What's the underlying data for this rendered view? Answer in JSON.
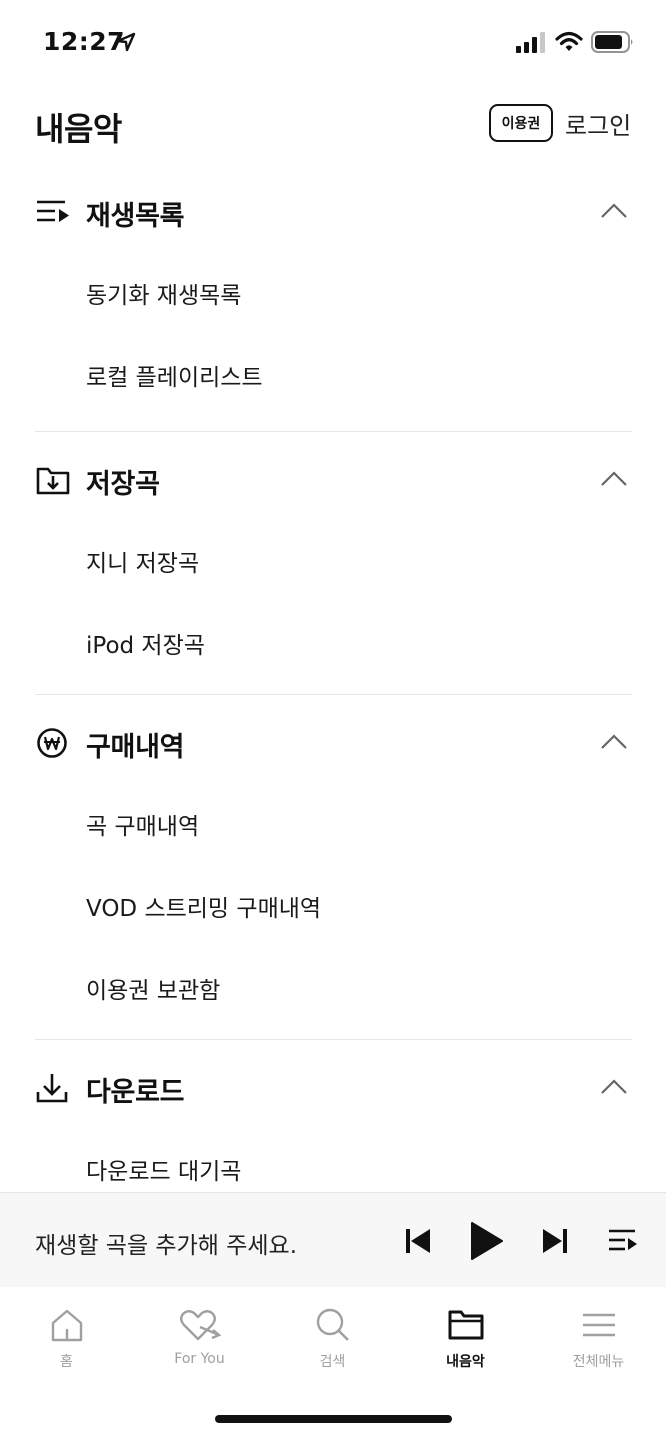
{
  "status_bar": {
    "time": "12:27"
  },
  "header": {
    "title": "내음악",
    "voucher_label": "이용권",
    "login_label": "로그인"
  },
  "sections": [
    {
      "title": "재생목록",
      "icon": "playlist-icon",
      "items": [
        "동기화 재생목록",
        "로컬 플레이리스트"
      ]
    },
    {
      "title": "저장곡",
      "icon": "folder-download-icon",
      "items": [
        "지니 저장곡",
        "iPod 저장곡"
      ]
    },
    {
      "title": "구매내역",
      "icon": "won-coin-icon",
      "items": [
        "곡 구매내역",
        "VOD 스트리밍 구매내역",
        "이용권 보관함"
      ]
    },
    {
      "title": "다운로드",
      "icon": "download-icon",
      "items": [
        "다운로드 대기곡"
      ]
    }
  ],
  "mini_player": {
    "message": "재생할 곡을 추가해 주세요."
  },
  "tabs": [
    {
      "label": "홈",
      "icon": "home-icon",
      "active": false
    },
    {
      "label": "For You",
      "icon": "heart-arrow-icon",
      "active": false
    },
    {
      "label": "검색",
      "icon": "search-icon",
      "active": false
    },
    {
      "label": "내음악",
      "icon": "folder-icon",
      "active": true
    },
    {
      "label": "전체메뉴",
      "icon": "menu-icon",
      "active": false
    }
  ],
  "colors": {
    "text": "#111111",
    "inactive_tab": "#a0a0a0",
    "divider": "#e6e6e6",
    "player_bg": "#f7f7f7"
  }
}
